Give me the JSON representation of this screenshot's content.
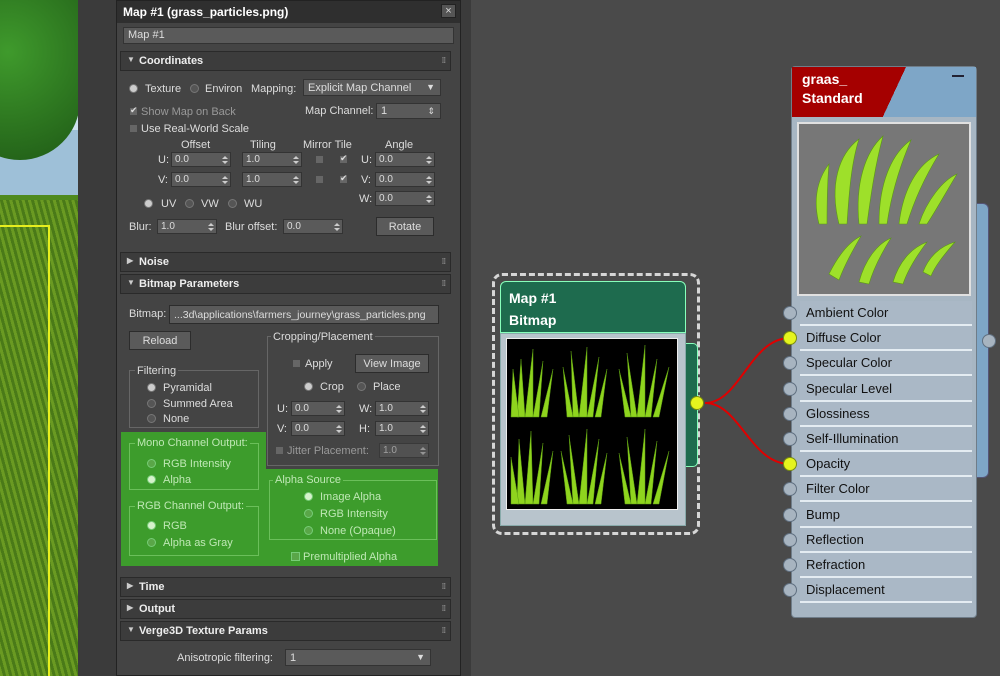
{
  "panel": {
    "title": "Map #1 (grass_particles.png)",
    "close": "×",
    "name": "Map #1"
  },
  "coordinates": {
    "header": "Coordinates",
    "texture": "Texture",
    "environ": "Environ",
    "mapping_label": "Mapping:",
    "mapping_value": "Explicit Map Channel",
    "show_map_on_back": "Show Map on Back",
    "map_channel_label": "Map Channel:",
    "map_channel_value": "1",
    "real_world": "Use Real-World Scale",
    "offset": "Offset",
    "tiling": "Tiling",
    "mirror_tile": "Mirror Tile",
    "angle": "Angle",
    "u_label": "U:",
    "v_label": "V:",
    "w_label": "W:",
    "u_offset": "0.0",
    "v_offset": "0.0",
    "u_tiling": "1.0",
    "v_tiling": "1.0",
    "u_angle": "0.0",
    "v_angle": "0.0",
    "w_angle": "0.0",
    "uv": "UV",
    "vw": "VW",
    "wu": "WU",
    "blur_label": "Blur:",
    "blur_value": "1.0",
    "blur_offset_label": "Blur offset:",
    "blur_offset_value": "0.0",
    "rotate": "Rotate"
  },
  "noise": {
    "header": "Noise"
  },
  "bitmap": {
    "header": "Bitmap Parameters",
    "bitmap_label": "Bitmap:",
    "bitmap_path": "...3d\\applications\\farmers_journey\\grass_particles.png",
    "reload": "Reload",
    "filtering": "Filtering",
    "pyramidal": "Pyramidal",
    "summed_area": "Summed Area",
    "none": "None",
    "cropping": "Cropping/Placement",
    "apply": "Apply",
    "view_image": "View Image",
    "crop": "Crop",
    "place": "Place",
    "u_label": "U:",
    "v_label": "V:",
    "w_label": "W:",
    "h_label": "H:",
    "u_value": "0.0",
    "v_value": "0.0",
    "w_value": "1.0",
    "h_value": "1.0",
    "jitter": "Jitter Placement:",
    "jitter_value": "1.0",
    "mono_output": "Mono Channel Output:",
    "rgb_intensity": "RGB Intensity",
    "alpha": "Alpha",
    "rgb_output": "RGB Channel Output:",
    "rgb": "RGB",
    "alpha_as_gray": "Alpha as Gray",
    "alpha_source": "Alpha Source",
    "image_alpha": "Image Alpha",
    "rgb_intensity2": "RGB Intensity",
    "none_opaque": "None (Opaque)",
    "premultiplied": "Premultiplied Alpha"
  },
  "time": {
    "header": "Time"
  },
  "output": {
    "header": "Output"
  },
  "verge": {
    "header": "Verge3D Texture Params",
    "aniso_label": "Anisotropic filtering:",
    "aniso_value": "1"
  },
  "bitmap_node": {
    "line1": "Map #1",
    "line2": "Bitmap"
  },
  "material_node": {
    "line1": "graas_",
    "line2": "Standard",
    "slots": [
      "Ambient Color",
      "Diffuse Color",
      "Specular Color",
      "Specular Level",
      "Glossiness",
      "Self-Illumination",
      "Opacity",
      "Filter Color",
      "Bump",
      "Reflection",
      "Refraction",
      "Displacement"
    ],
    "connected_slots": [
      "Diffuse Color",
      "Opacity"
    ]
  },
  "colors": {
    "bitmap_node_header": "#1e6b4e",
    "material_header_red": "#a50000",
    "wire": "#e00000",
    "socket_active": "#e5f41e",
    "highlight_green": "#3d9c2c"
  }
}
